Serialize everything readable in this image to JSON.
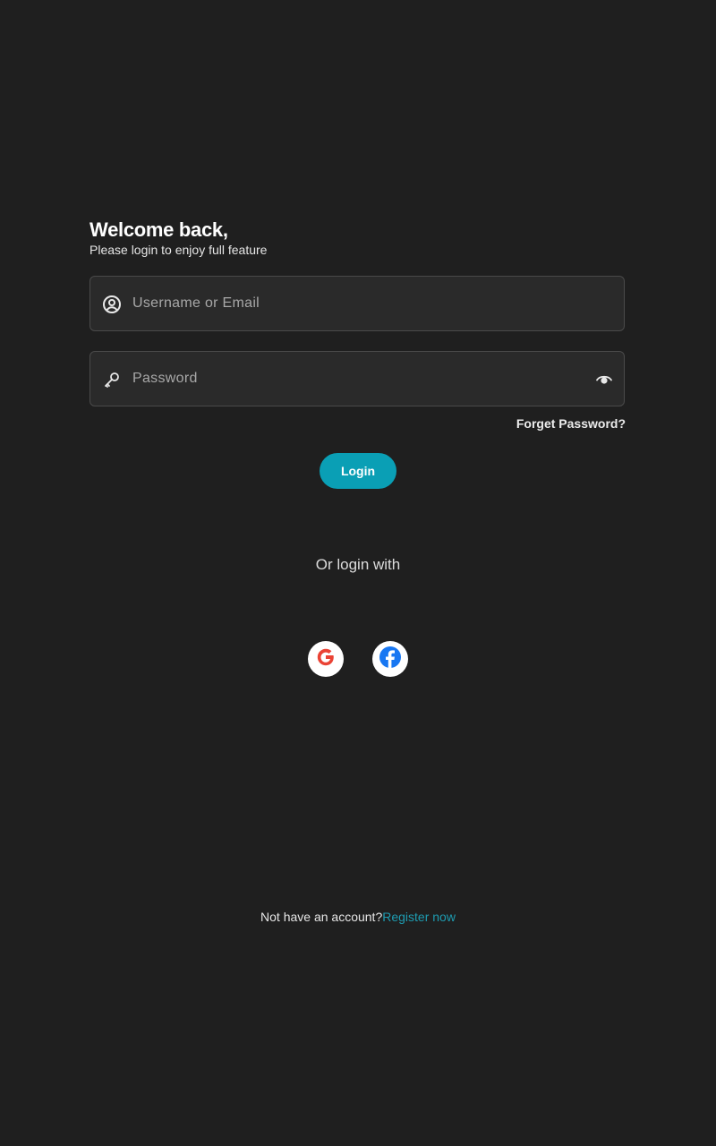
{
  "header": {
    "title": "Welcome back,",
    "subtitle": "Please login to enjoy full feature"
  },
  "form": {
    "username": {
      "placeholder": "Username or Email",
      "value": "",
      "icon": "user-circle-icon"
    },
    "password": {
      "placeholder": "Password",
      "value": "",
      "icon": "key-icon",
      "toggle_icon": "eye-icon"
    },
    "forgot_label": "Forget Password?",
    "login_label": "Login"
  },
  "social": {
    "label": "Or login with",
    "providers": [
      {
        "name": "google",
        "icon": "google-icon"
      },
      {
        "name": "facebook",
        "icon": "facebook-icon"
      }
    ]
  },
  "footer": {
    "prompt": "Not have an account?",
    "register_label": "Register now"
  },
  "colors": {
    "background": "#1f1f1f",
    "field_background": "#2a2a2a",
    "field_border": "#4a4a4a",
    "accent": "#0a9fb5",
    "link": "#1e9bb0"
  }
}
